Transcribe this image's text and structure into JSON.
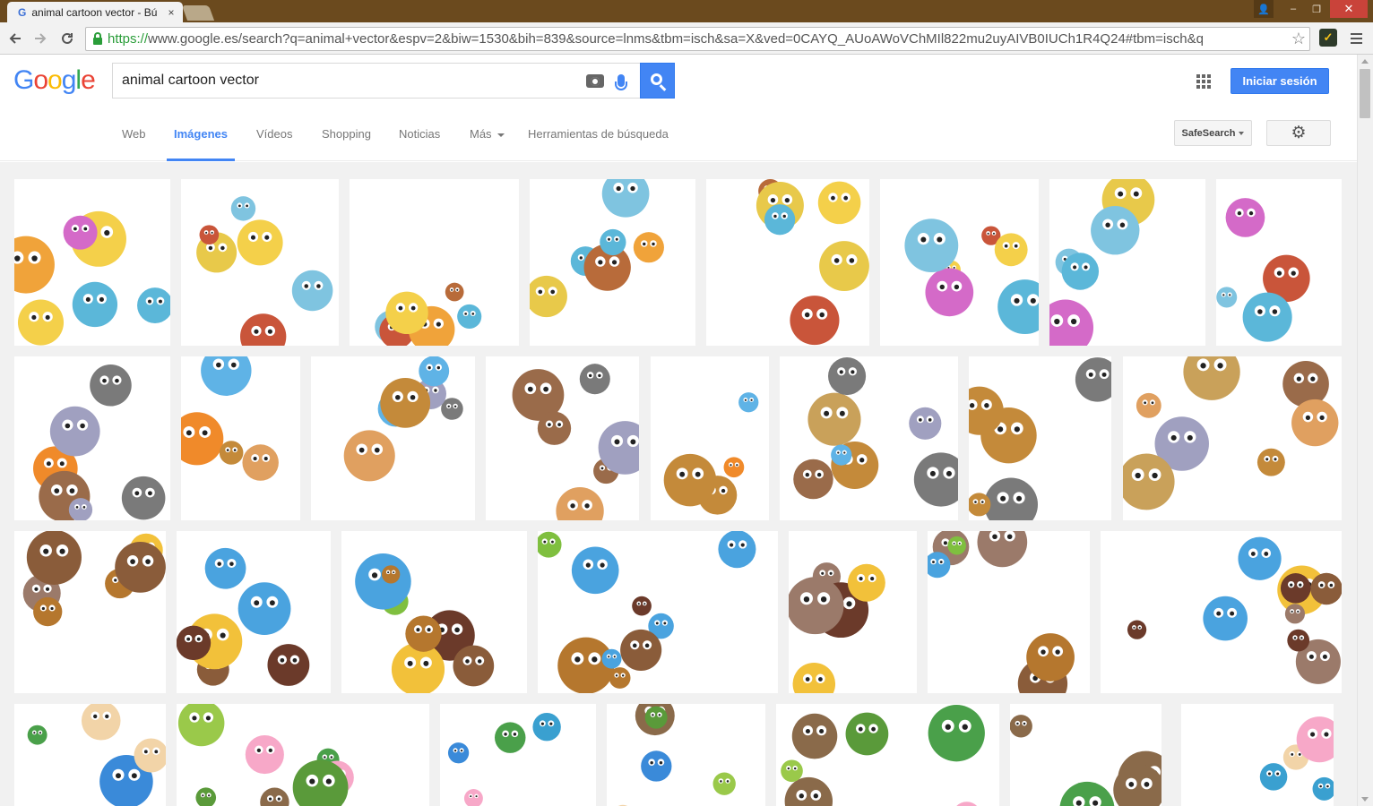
{
  "browser": {
    "tab_title": "animal cartoon vector - Bú",
    "tab_close": "×",
    "url_scheme": "https://",
    "url_rest": "www.google.es/search?q=animal+vector&espv=2&biw=1530&bih=839&source=lnms&tbm=isch&sa=X&ved=0CAYQ_AUoAWoVChMIl822mu2uyAIVB0IUCh1R4Q24#tbm=isch&q",
    "extension_glyph": "✓",
    "window_controls": {
      "user": "👤",
      "minimize": "–",
      "maximize": "❐",
      "close": "✕"
    }
  },
  "colors": {
    "titlebar": "#6b4a1e",
    "google_blue": "#4285f4",
    "google_red": "#ea4335",
    "google_yellow": "#fbbc05",
    "google_green": "#34a853",
    "secure_green": "#2a9d39"
  },
  "google": {
    "logo_letters": [
      "G",
      "o",
      "o",
      "g",
      "l",
      "e"
    ],
    "search_query": "animal cartoon vector",
    "signin_label": "Iniciar sesión"
  },
  "nav": {
    "tabs": [
      {
        "label": "Web",
        "active": false
      },
      {
        "label": "Imágenes",
        "active": true
      },
      {
        "label": "Vídeos",
        "active": false
      },
      {
        "label": "Shopping",
        "active": false
      },
      {
        "label": "Noticias",
        "active": false
      },
      {
        "label": "Más",
        "active": false,
        "has_caret": true
      },
      {
        "label": "Herramientas de búsqueda",
        "active": false
      }
    ],
    "safesearch_label": "SafeSearch",
    "settings_icon": "gear-icon"
  },
  "icons": {
    "back": "arrow-left-icon",
    "forward": "arrow-right-icon",
    "reload": "reload-icon",
    "lock": "lock-icon",
    "star": "star-icon",
    "camera": "camera-icon",
    "mic": "microphone-icon",
    "search": "search-icon",
    "apps": "apps-grid-icon",
    "menu": "hamburger-menu-icon"
  },
  "results": {
    "rows": [
      {
        "count": 8,
        "palette": [
          "#d46ac8",
          "#5bb7d9",
          "#f0a33a",
          "#c9553a",
          "#e8c94a",
          "#7fc4e0",
          "#f4d04a",
          "#b86b3a"
        ]
      },
      {
        "count": 8,
        "palette": [
          "#c48a3a",
          "#7a7a7a",
          "#f08a2a",
          "#5fb3e6",
          "#9a6b4a",
          "#c9a15a",
          "#a0a0c0",
          "#e0a060"
        ]
      },
      {
        "count": 7,
        "palette": [
          "#b5772e",
          "#7fbf3f",
          "#8a5c3a",
          "#4aa3df",
          "#9b7a6a",
          "#6b3a2a",
          "#f2c13a"
        ]
      },
      {
        "count": 8,
        "palette": [
          "#f7a8c8",
          "#f2d4a8",
          "#8a6a4a",
          "#4aa04a",
          "#3a8ad9",
          "#9ac94a",
          "#3aa0d0",
          "#5a9a3a"
        ]
      }
    ]
  }
}
